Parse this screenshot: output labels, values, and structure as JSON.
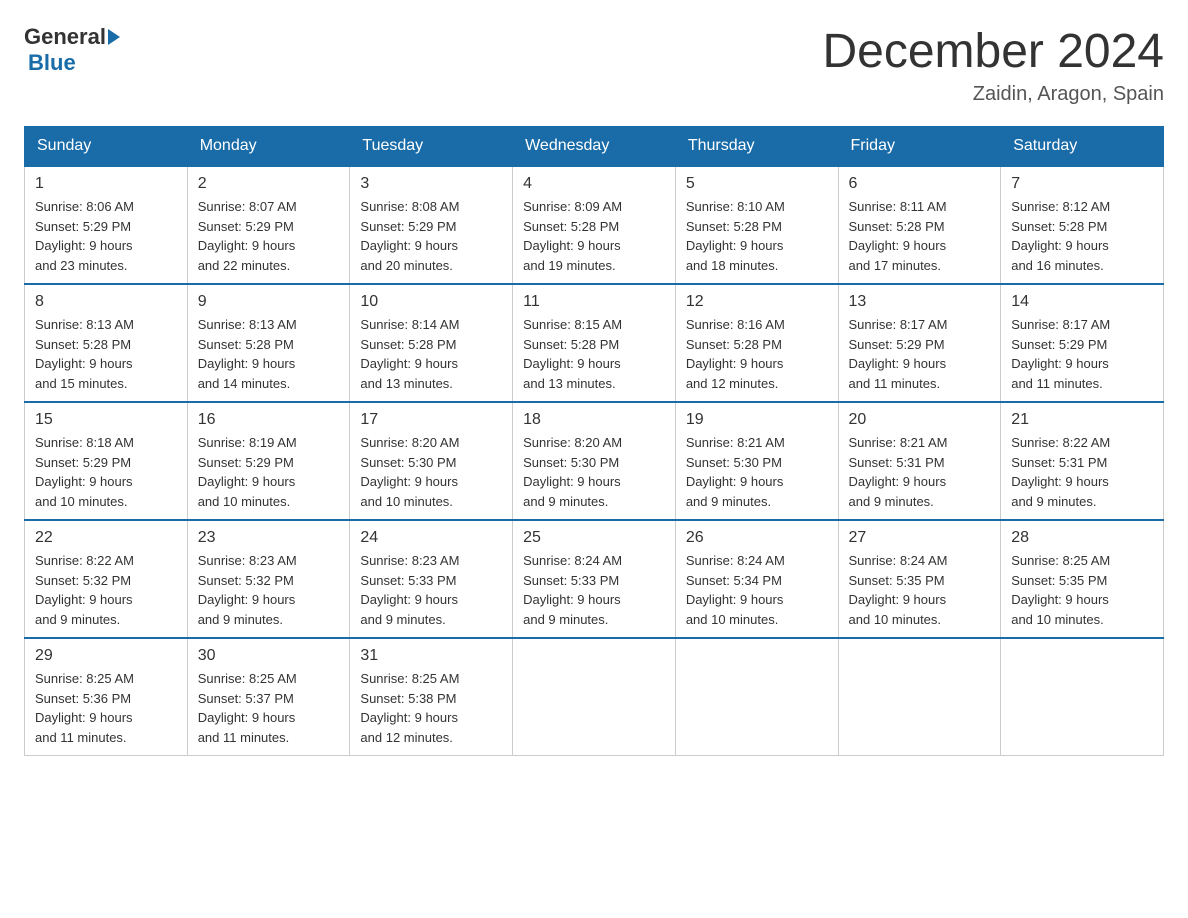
{
  "header": {
    "logo_general": "General",
    "logo_blue": "Blue",
    "month_title": "December 2024",
    "location": "Zaidin, Aragon, Spain"
  },
  "weekdays": [
    "Sunday",
    "Monday",
    "Tuesday",
    "Wednesday",
    "Thursday",
    "Friday",
    "Saturday"
  ],
  "weeks": [
    [
      {
        "day": "1",
        "sunrise": "8:06 AM",
        "sunset": "5:29 PM",
        "daylight": "9 hours and 23 minutes."
      },
      {
        "day": "2",
        "sunrise": "8:07 AM",
        "sunset": "5:29 PM",
        "daylight": "9 hours and 22 minutes."
      },
      {
        "day": "3",
        "sunrise": "8:08 AM",
        "sunset": "5:29 PM",
        "daylight": "9 hours and 20 minutes."
      },
      {
        "day": "4",
        "sunrise": "8:09 AM",
        "sunset": "5:28 PM",
        "daylight": "9 hours and 19 minutes."
      },
      {
        "day": "5",
        "sunrise": "8:10 AM",
        "sunset": "5:28 PM",
        "daylight": "9 hours and 18 minutes."
      },
      {
        "day": "6",
        "sunrise": "8:11 AM",
        "sunset": "5:28 PM",
        "daylight": "9 hours and 17 minutes."
      },
      {
        "day": "7",
        "sunrise": "8:12 AM",
        "sunset": "5:28 PM",
        "daylight": "9 hours and 16 minutes."
      }
    ],
    [
      {
        "day": "8",
        "sunrise": "8:13 AM",
        "sunset": "5:28 PM",
        "daylight": "9 hours and 15 minutes."
      },
      {
        "day": "9",
        "sunrise": "8:13 AM",
        "sunset": "5:28 PM",
        "daylight": "9 hours and 14 minutes."
      },
      {
        "day": "10",
        "sunrise": "8:14 AM",
        "sunset": "5:28 PM",
        "daylight": "9 hours and 13 minutes."
      },
      {
        "day": "11",
        "sunrise": "8:15 AM",
        "sunset": "5:28 PM",
        "daylight": "9 hours and 13 minutes."
      },
      {
        "day": "12",
        "sunrise": "8:16 AM",
        "sunset": "5:28 PM",
        "daylight": "9 hours and 12 minutes."
      },
      {
        "day": "13",
        "sunrise": "8:17 AM",
        "sunset": "5:29 PM",
        "daylight": "9 hours and 11 minutes."
      },
      {
        "day": "14",
        "sunrise": "8:17 AM",
        "sunset": "5:29 PM",
        "daylight": "9 hours and 11 minutes."
      }
    ],
    [
      {
        "day": "15",
        "sunrise": "8:18 AM",
        "sunset": "5:29 PM",
        "daylight": "9 hours and 10 minutes."
      },
      {
        "day": "16",
        "sunrise": "8:19 AM",
        "sunset": "5:29 PM",
        "daylight": "9 hours and 10 minutes."
      },
      {
        "day": "17",
        "sunrise": "8:20 AM",
        "sunset": "5:30 PM",
        "daylight": "9 hours and 10 minutes."
      },
      {
        "day": "18",
        "sunrise": "8:20 AM",
        "sunset": "5:30 PM",
        "daylight": "9 hours and 9 minutes."
      },
      {
        "day": "19",
        "sunrise": "8:21 AM",
        "sunset": "5:30 PM",
        "daylight": "9 hours and 9 minutes."
      },
      {
        "day": "20",
        "sunrise": "8:21 AM",
        "sunset": "5:31 PM",
        "daylight": "9 hours and 9 minutes."
      },
      {
        "day": "21",
        "sunrise": "8:22 AM",
        "sunset": "5:31 PM",
        "daylight": "9 hours and 9 minutes."
      }
    ],
    [
      {
        "day": "22",
        "sunrise": "8:22 AM",
        "sunset": "5:32 PM",
        "daylight": "9 hours and 9 minutes."
      },
      {
        "day": "23",
        "sunrise": "8:23 AM",
        "sunset": "5:32 PM",
        "daylight": "9 hours and 9 minutes."
      },
      {
        "day": "24",
        "sunrise": "8:23 AM",
        "sunset": "5:33 PM",
        "daylight": "9 hours and 9 minutes."
      },
      {
        "day": "25",
        "sunrise": "8:24 AM",
        "sunset": "5:33 PM",
        "daylight": "9 hours and 9 minutes."
      },
      {
        "day": "26",
        "sunrise": "8:24 AM",
        "sunset": "5:34 PM",
        "daylight": "9 hours and 10 minutes."
      },
      {
        "day": "27",
        "sunrise": "8:24 AM",
        "sunset": "5:35 PM",
        "daylight": "9 hours and 10 minutes."
      },
      {
        "day": "28",
        "sunrise": "8:25 AM",
        "sunset": "5:35 PM",
        "daylight": "9 hours and 10 minutes."
      }
    ],
    [
      {
        "day": "29",
        "sunrise": "8:25 AM",
        "sunset": "5:36 PM",
        "daylight": "9 hours and 11 minutes."
      },
      {
        "day": "30",
        "sunrise": "8:25 AM",
        "sunset": "5:37 PM",
        "daylight": "9 hours and 11 minutes."
      },
      {
        "day": "31",
        "sunrise": "8:25 AM",
        "sunset": "5:38 PM",
        "daylight": "9 hours and 12 minutes."
      },
      null,
      null,
      null,
      null
    ]
  ],
  "labels": {
    "sunrise_prefix": "Sunrise: ",
    "sunset_prefix": "Sunset: ",
    "daylight_prefix": "Daylight: "
  }
}
